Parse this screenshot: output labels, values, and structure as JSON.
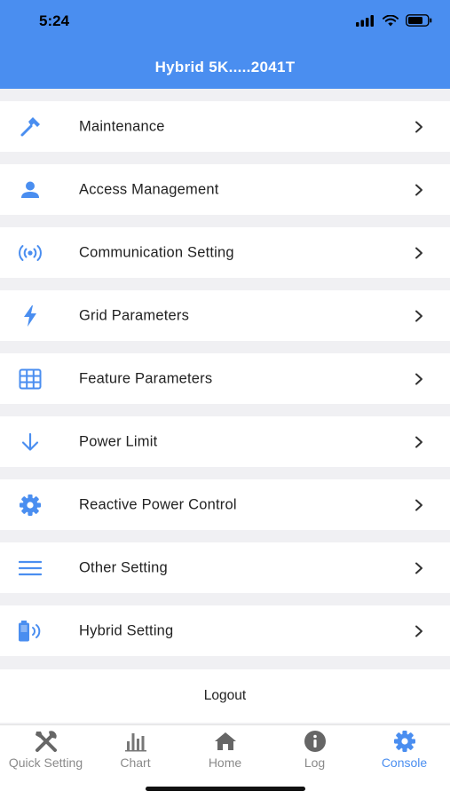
{
  "status_bar": {
    "time": "5:24"
  },
  "header": {
    "title": "Hybrid 5K.....2041T",
    "bg_color": "#4a8ef0"
  },
  "menu_items": [
    {
      "label": "Maintenance",
      "icon": "hammer-icon"
    },
    {
      "label": "Access Management",
      "icon": "user-icon"
    },
    {
      "label": "Communication Setting",
      "icon": "broadcast-icon"
    },
    {
      "label": "Grid Parameters",
      "icon": "lightning-icon"
    },
    {
      "label": "Feature Parameters",
      "icon": "grid-icon"
    },
    {
      "label": "Power Limit",
      "icon": "arrow-down-icon"
    },
    {
      "label": "Reactive Power Control",
      "icon": "gear-icon"
    },
    {
      "label": "Other Setting",
      "icon": "menu-lines-icon"
    },
    {
      "label": "Hybrid Setting",
      "icon": "battery-signal-icon"
    }
  ],
  "logout_label": "Logout",
  "tabs": [
    {
      "label": "Quick Setting",
      "icon": "tools-icon",
      "active": false
    },
    {
      "label": "Chart",
      "icon": "bar-chart-icon",
      "active": false
    },
    {
      "label": "Home",
      "icon": "home-icon",
      "active": false
    },
    {
      "label": "Log",
      "icon": "info-icon",
      "active": false
    },
    {
      "label": "Console",
      "icon": "gear-icon",
      "active": true
    }
  ],
  "accent_color": "#4a8ef0"
}
